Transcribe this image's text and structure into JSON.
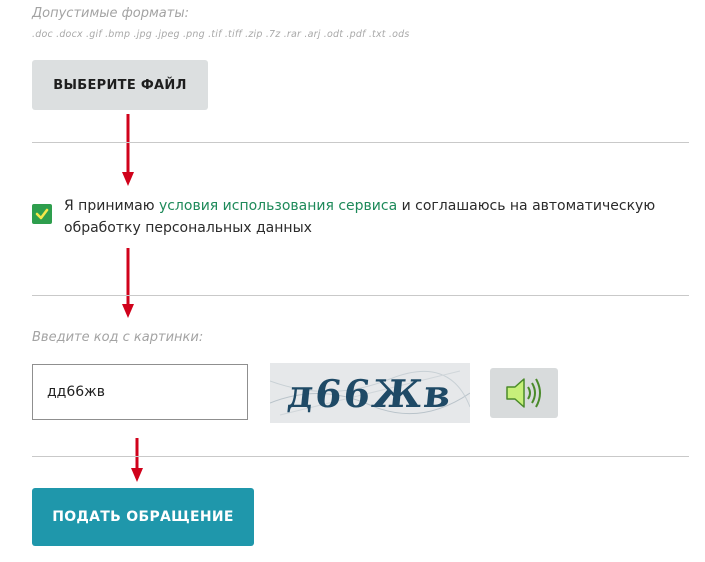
{
  "upload": {
    "formats_label": "Допустимые форматы:",
    "formats_list": ".doc .docx .gif .bmp .jpg .jpeg .png .tif .tiff .zip .7z .rar .arj .odt .pdf .txt .ods",
    "button_label": "ВЫБЕРИТЕ ФАЙЛ"
  },
  "consent": {
    "checked": true,
    "prefix": "Я принимаю ",
    "link_text": "условия использования сервиса",
    "suffix": " и соглашаюсь на автоматическую обработку персональных данных"
  },
  "captcha": {
    "label": "Введите код с картинки:",
    "input_value": "дд66жв",
    "image_text": "д66Жв",
    "audio_icon": "speaker-icon"
  },
  "submit": {
    "label": "ПОДАТЬ ОБРАЩЕНИЕ"
  },
  "colors": {
    "accent": "#1f97ab",
    "checkbox": "#2e9e4d",
    "link": "#1e8a5a",
    "arrow": "#d0021b",
    "button_gray": "#dcdfe0"
  }
}
